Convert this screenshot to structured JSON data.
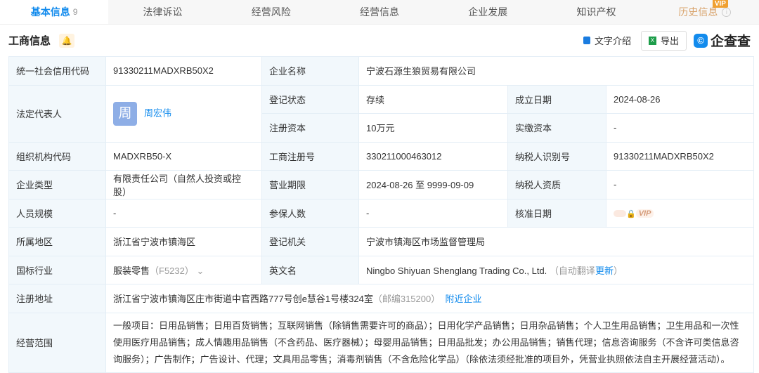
{
  "tabs": [
    {
      "label": "基本信息",
      "count": "9"
    },
    {
      "label": "法律诉讼"
    },
    {
      "label": "经营风险"
    },
    {
      "label": "经营信息"
    },
    {
      "label": "企业发展"
    },
    {
      "label": "知识产权"
    },
    {
      "label": "历史信息",
      "badge": "VIP"
    }
  ],
  "section": {
    "title": "工商信息",
    "text_intro": "文字介绍",
    "export": "导出",
    "logo": "企查查"
  },
  "rows": {
    "credit_code": {
      "label": "统一社会信用代码",
      "value": "91330211MADXRB50X2"
    },
    "company_name": {
      "label": "企业名称",
      "value": "宁波石源生狼贸易有限公司"
    },
    "legal_rep": {
      "label": "法定代表人",
      "avatar": "周",
      "value": "周宏伟"
    },
    "reg_status": {
      "label": "登记状态",
      "value": "存续"
    },
    "found_date": {
      "label": "成立日期",
      "value": "2024-08-26"
    },
    "reg_capital": {
      "label": "注册资本",
      "value": "10万元"
    },
    "paid_capital": {
      "label": "实缴资本",
      "value": "-"
    },
    "org_code": {
      "label": "组织机构代码",
      "value": "MADXRB50-X"
    },
    "biz_reg_no": {
      "label": "工商注册号",
      "value": "330211000463012"
    },
    "taxpayer_id": {
      "label": "纳税人识别号",
      "value": "91330211MADXRB50X2"
    },
    "company_type": {
      "label": "企业类型",
      "value": "有限责任公司（自然人投资或控股）"
    },
    "biz_term": {
      "label": "营业期限",
      "value": "2024-08-26 至 9999-09-09"
    },
    "taxpayer_qual": {
      "label": "纳税人资质",
      "value": "-"
    },
    "staff_size": {
      "label": "人员规模",
      "value": "-"
    },
    "insured": {
      "label": "参保人数",
      "value": "-"
    },
    "approve_date": {
      "label": "核准日期",
      "value": "VIP"
    },
    "region": {
      "label": "所属地区",
      "value": "浙江省宁波市镇海区"
    },
    "reg_authority": {
      "label": "登记机关",
      "value": "宁波市镇海区市场监督管理局"
    },
    "industry": {
      "label": "国标行业",
      "value": "服装零售",
      "code": "（F5232）"
    },
    "english_name": {
      "label": "英文名",
      "value": "Ningbo Shiyuan Shenglang Trading Co., Ltd.",
      "note_pre": "（自动翻译",
      "note_link": "更新",
      "note_post": "）"
    },
    "address": {
      "label": "注册地址",
      "value": "浙江省宁波市镇海区庄市街道中官西路777号创e慧谷1号楼324室",
      "postcode": "（邮编315200）",
      "nearby": "附近企业"
    },
    "scope": {
      "label": "经营范围",
      "value": "一般项目：日用品销售；日用百货销售；互联网销售（除销售需要许可的商品）；日用化学产品销售；日用杂品销售；个人卫生用品销售；卫生用品和一次性使用医疗用品销售；成人情趣用品销售（不含药品、医疗器械）；母婴用品销售；日用品批发；办公用品销售；销售代理；信息咨询服务（不含许可类信息咨询服务）；广告制作；广告设计、代理；文具用品零售；消毒剂销售（不含危险化学品）（除依法须经批准的项目外，凭营业执照依法自主开展经营活动）。"
    }
  }
}
